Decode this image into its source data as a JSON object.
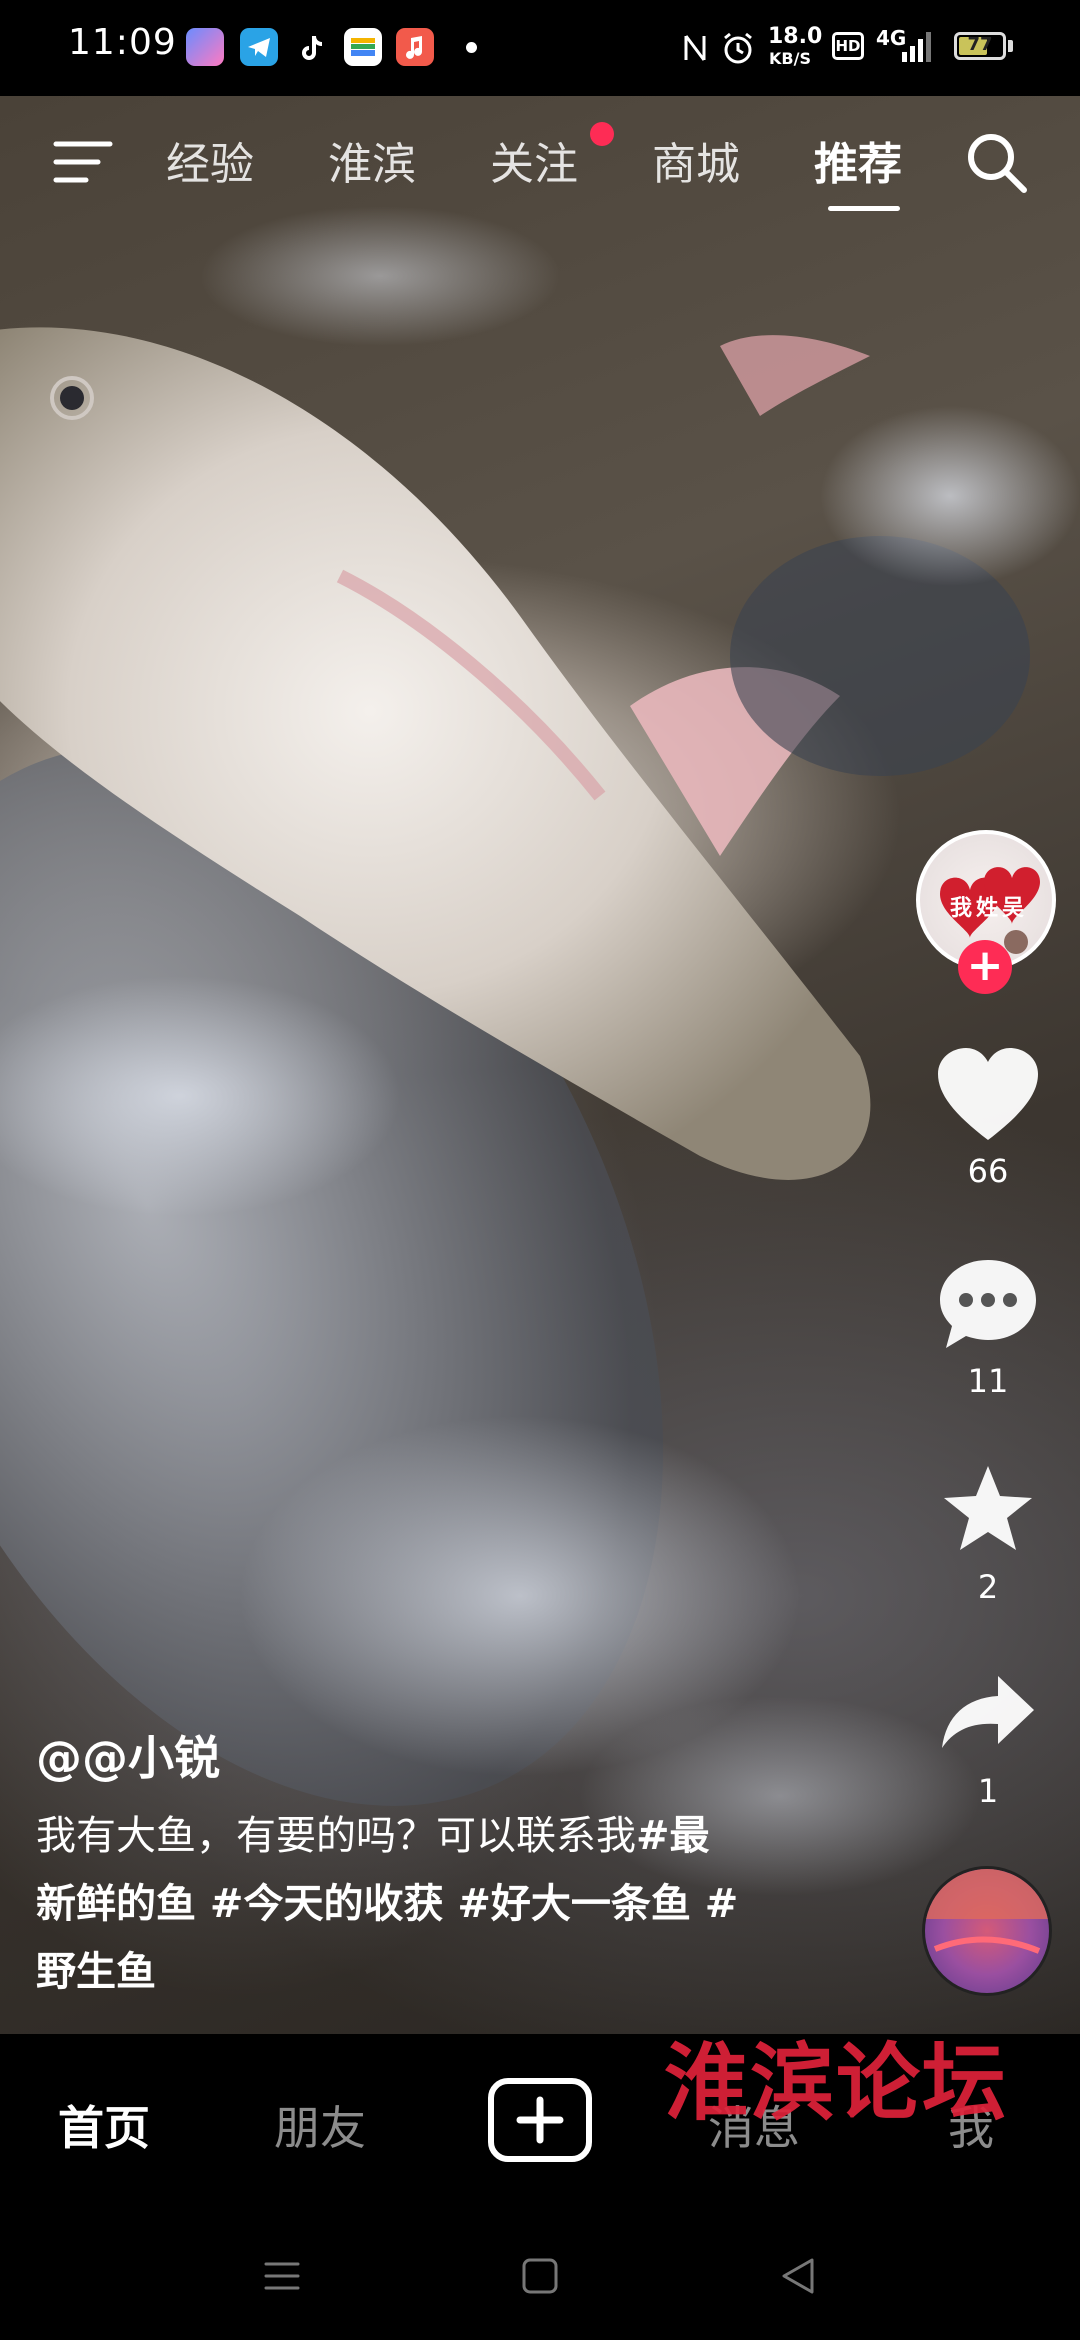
{
  "status_bar": {
    "time": "11:09",
    "network_speed_value": "18.0",
    "network_speed_unit": "KB/S",
    "hd_label": "HD",
    "signal_label": "4G",
    "battery_level": "77"
  },
  "top_nav": {
    "tabs": [
      {
        "label": "经验"
      },
      {
        "label": "淮滨"
      },
      {
        "label": "关注"
      },
      {
        "label": "商城"
      },
      {
        "label": "推荐"
      }
    ],
    "active_tab": "推荐"
  },
  "right_rail": {
    "likes": "66",
    "comments": "11",
    "favorites": "2",
    "shares": "1",
    "avatar_text": "我姓吴"
  },
  "post": {
    "username": "@@小锐",
    "caption_text": "我有大鱼，有要的吗？可以联系我",
    "caption_tags_line1": "#最",
    "caption_tags_line2": "新鲜的鱼 #今天的收获 #好大一条鱼 #",
    "caption_tags_line3": "野生鱼"
  },
  "bottom_nav": {
    "tabs": [
      {
        "label": "首页"
      },
      {
        "label": "朋友"
      },
      {
        "label": "消息"
      },
      {
        "label": "我"
      }
    ],
    "active_tab": "首页"
  },
  "watermark": "淮滨论坛",
  "colors": {
    "accent": "#fe2c55",
    "watermark": "#e0223a",
    "background": "#000000"
  }
}
